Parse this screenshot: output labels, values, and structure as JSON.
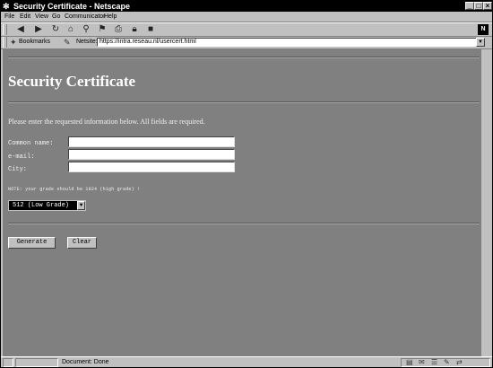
{
  "window": {
    "title": "Security Certificate - Netscape",
    "app_icon": "netscape-n-icon"
  },
  "menu": [
    "File",
    "Edit",
    "View",
    "Go",
    "Communicator",
    "Help"
  ],
  "toolbar": {
    "buttons": [
      "back-icon",
      "forward-icon",
      "reload-icon",
      "home-icon",
      "search-icon",
      "guide-icon",
      "print-icon",
      "security-icon",
      "stop-icon"
    ]
  },
  "location": {
    "bookmarks_label": "Bookmarks",
    "netsite_label": "Netsite:",
    "url": "https://intra.reseau.nl/usercert.html"
  },
  "page": {
    "title": "Security Certificate",
    "intro": "Please enter the requested information below.  All fields are required.",
    "fields": [
      {
        "label": "Common name:",
        "value": ""
      },
      {
        "label": "e-mail:",
        "value": ""
      },
      {
        "label": "City:",
        "value": ""
      }
    ],
    "note": "NOTE: your grade should be 1024 (high grade) !",
    "grade_select": {
      "selected": "512 (Low Grade)"
    },
    "generate_label": "Generate",
    "clear_label": "Clear"
  },
  "status": {
    "text": "Document: Done"
  },
  "colors": {
    "page_background": "#808080",
    "title_bar": "#000000",
    "chrome": "#c0c0c0"
  }
}
